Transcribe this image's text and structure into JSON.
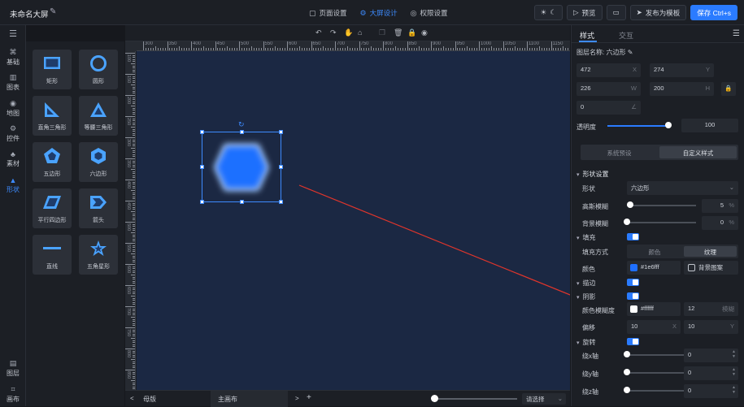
{
  "app": {
    "title": "未命名大屏"
  },
  "nav": {
    "tabs": [
      {
        "label": "页面设置"
      },
      {
        "label": "大屏设计"
      },
      {
        "label": "权限设置"
      }
    ]
  },
  "actions": {
    "preview": "预览",
    "publish": "发布为模板",
    "save": "保存 Ctrl+s"
  },
  "rail": {
    "items": [
      {
        "label": "基础"
      },
      {
        "label": "图表"
      },
      {
        "label": "地图"
      },
      {
        "label": "控件"
      },
      {
        "label": "素材"
      },
      {
        "label": "形状"
      }
    ],
    "bottom": [
      {
        "label": "图层"
      },
      {
        "label": "画布"
      }
    ]
  },
  "shapes": [
    {
      "label": "矩形"
    },
    {
      "label": "圆形"
    },
    {
      "label": "直角三角形"
    },
    {
      "label": "等腰三角形"
    },
    {
      "label": "五边形"
    },
    {
      "label": "六边形"
    },
    {
      "label": "平行四边形"
    },
    {
      "label": "箭头"
    },
    {
      "label": "直线"
    },
    {
      "label": "五角星形"
    }
  ],
  "ruler": {
    "h": [
      "300",
      "350",
      "400",
      "450",
      "500",
      "550",
      "600",
      "650",
      "700",
      "750",
      "800",
      "850",
      "900",
      "950",
      "1000",
      "1050",
      "1100",
      "1150"
    ],
    "v": [
      "100",
      "150",
      "200",
      "250",
      "300",
      "350",
      "400",
      "450",
      "500",
      "550",
      "600",
      "650",
      "700",
      "750",
      "800",
      "850",
      "900"
    ]
  },
  "bottom": {
    "prev": "<",
    "page": "母版",
    "main": "主画布",
    "next": ">",
    "add": "+",
    "select": "请选择"
  },
  "panel": {
    "tabs": [
      "样式",
      "交互"
    ],
    "layer_name_label": "图层名称:",
    "layer_name": "六边形",
    "x": "472",
    "x_suf": "X",
    "y": "274",
    "y_suf": "Y",
    "w": "226",
    "w_suf": "W",
    "h": "200",
    "h_suf": "H",
    "rotate": "0",
    "opacity_label": "透明度",
    "opacity": "100",
    "preset_tab": "系统预设",
    "custom_tab": "自定义样式",
    "shape_section": "形状设置",
    "shape_label": "形状",
    "shape_value": "六边形",
    "blur_label": "高斯模糊",
    "blur_value": "5",
    "bg_blur_label": "背景模糊",
    "bg_blur_value": "0",
    "pct": "%",
    "fill_label": "填充",
    "fill_mode_label": "填充方式",
    "fill_color_opt": "颜色",
    "fill_texture_opt": "纹理",
    "color_label": "颜色",
    "color_value": "#1e6fff",
    "bg_pattern": "背景图案",
    "stroke_label": "描边",
    "shadow_label": "阴影",
    "shadow_color_label": "颜色模糊度",
    "shadow_color": "#ffffff",
    "shadow_blur": "12",
    "shadow_blur_suf": "模糊",
    "offset_label": "偏移",
    "offset_x": "10",
    "offset_y": "10",
    "rotate_label": "旋转",
    "rot_x_label": "绕x轴",
    "rot_y_label": "绕y轴",
    "rot_z_label": "绕z轴",
    "rot_x": "0",
    "rot_y": "0",
    "rot_z": "0"
  },
  "colors": {
    "accent": "#2a7bff",
    "shape_fill": "#1e6fff",
    "canvas": "#1b2843"
  }
}
